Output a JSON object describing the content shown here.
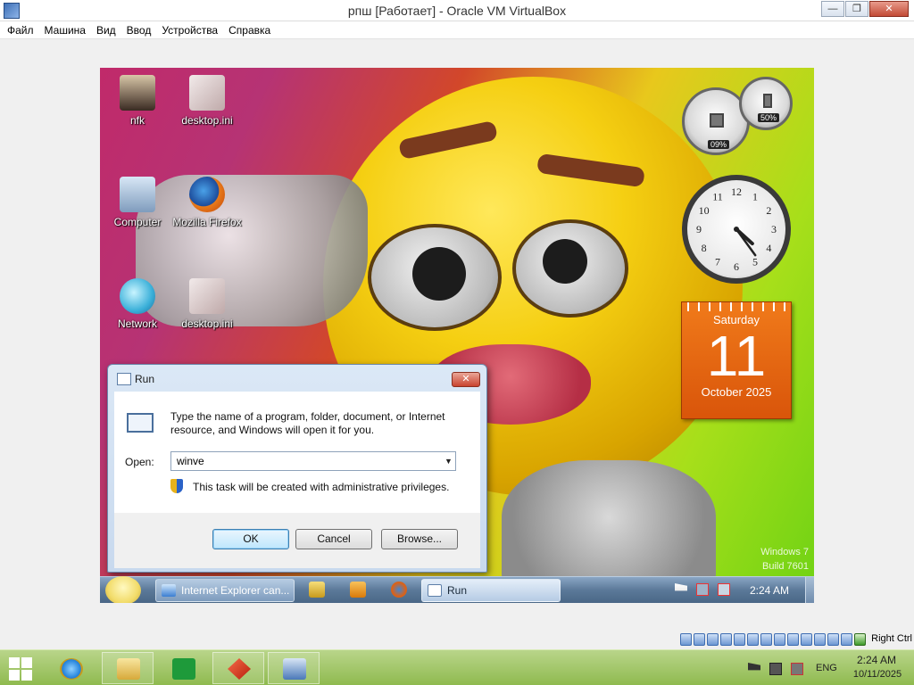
{
  "host_window": {
    "title": "рпш [Работает] - Oracle VM VirtualBox",
    "minimize": "—",
    "restore": "❐",
    "close": "✕"
  },
  "host_menu": [
    "Файл",
    "Машина",
    "Вид",
    "Ввод",
    "Устройства",
    "Справка"
  ],
  "desktop_icons": [
    {
      "label": "nfk",
      "icon": "person-file-icon"
    },
    {
      "label": "desktop.ini",
      "icon": "config-file-icon"
    },
    {
      "label": "Computer",
      "icon": "computer-icon"
    },
    {
      "label": "Mozilla Firefox",
      "icon": "firefox-icon"
    },
    {
      "label": "Network",
      "icon": "network-icon"
    },
    {
      "label": "desktop.ini",
      "icon": "config-file-icon"
    }
  ],
  "gadgets": {
    "cpu_percent": "09%",
    "memory_percent": "50%",
    "clock": {
      "hour": 4,
      "minute": 24
    },
    "calendar": {
      "day_name": "Saturday",
      "day_number": "11",
      "month_year": "October 2025"
    }
  },
  "watermark": {
    "line1": "Windows 7",
    "line2": "Build 7601"
  },
  "run_dialog": {
    "title": "Run",
    "description": "Type the name of a program, folder, document, or Internet resource, and Windows will open it for you.",
    "open_label": "Open:",
    "open_value": "winve",
    "admin_note": "This task will be created with administrative privileges.",
    "ok": "OK",
    "cancel": "Cancel",
    "browse": "Browse..."
  },
  "vm_taskbar": {
    "tasks": [
      "Internet Explorer can...",
      "Run"
    ],
    "clock": "2:24 AM"
  },
  "vbox_status": {
    "host_key": "Right Ctrl"
  },
  "host_taskbar": {
    "language": "ENG",
    "time": "2:24 AM",
    "date": "10/11/2025"
  },
  "colors": {
    "calendar_orange": "#e8660f",
    "dialog_frame": "#c8d9ee",
    "host_taskbar_green": "#9fc45e"
  }
}
